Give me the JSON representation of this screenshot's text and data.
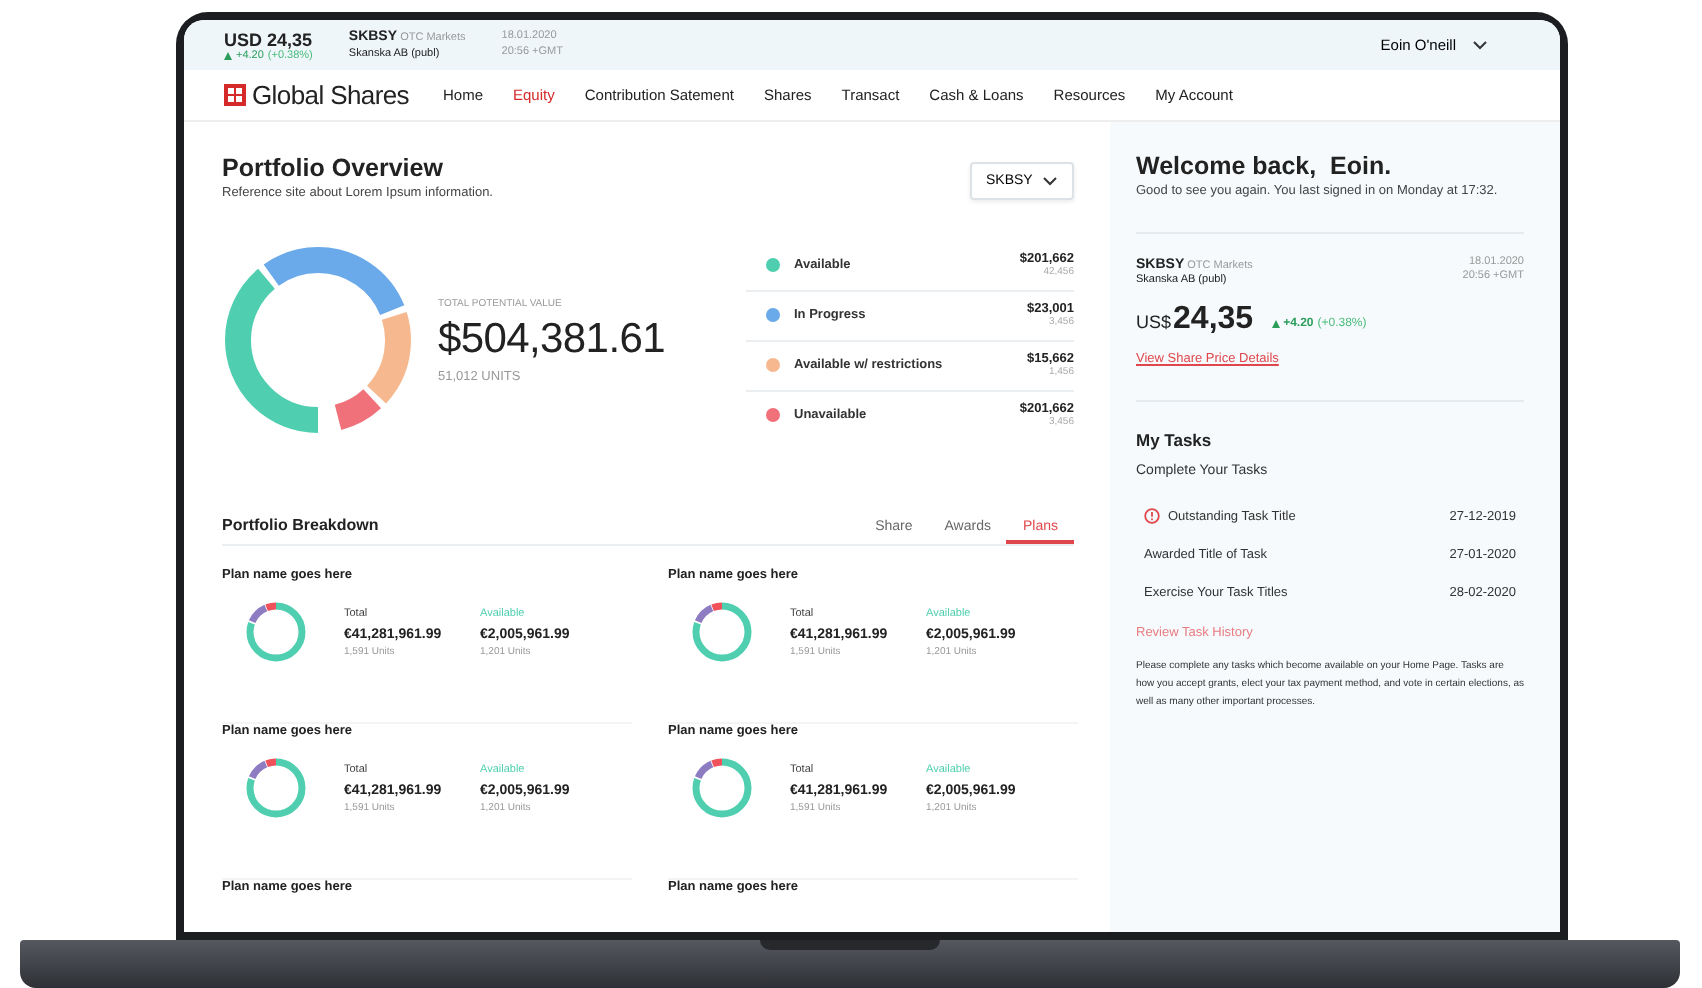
{
  "ticker": {
    "price": "USD 24,35",
    "change": "+4.20",
    "change_pct": "(+0.38%)",
    "symbol": "SKBSY",
    "market": "OTC Markets",
    "company": "Skanska AB (publ)",
    "date": "18.01.2020",
    "time": "20:56 +GMT",
    "user": "Eoin O'neill"
  },
  "brand": "Global Shares",
  "nav": [
    {
      "label": "Home",
      "selected": false
    },
    {
      "label": "Equity",
      "selected": true
    },
    {
      "label": "Contribution Satement",
      "selected": false
    },
    {
      "label": "Shares",
      "selected": false
    },
    {
      "label": "Transact",
      "selected": false
    },
    {
      "label": "Cash & Loans",
      "selected": false
    },
    {
      "label": "Resources",
      "selected": false
    },
    {
      "label": "My Account",
      "selected": false
    }
  ],
  "overview": {
    "title": "Portfolio Overview",
    "subtitle": "Reference site about Lorem Ipsum information.",
    "dropdown": "SKBSY",
    "total_label": "TOTAL POTENTIAL VALUE",
    "total": "$504,381.61",
    "units": "51,012 UNITS",
    "legend": [
      {
        "label": "Available",
        "value": "$201,662",
        "units": "42,456",
        "color": "#4fcfb0"
      },
      {
        "label": "In Progress",
        "value": "$23,001",
        "units": "3,456",
        "color": "#6aa9ea"
      },
      {
        "label": "Available w/ restrictions",
        "value": "$15,662",
        "units": "1,456",
        "color": "#f6b98f"
      },
      {
        "label": "Unavailable",
        "value": "$201,662",
        "units": "3,456",
        "color": "#f0717a"
      }
    ]
  },
  "breakdown": {
    "title": "Portfolio Breakdown",
    "tabs": [
      {
        "label": "Share",
        "selected": false
      },
      {
        "label": "Awards",
        "selected": false
      },
      {
        "label": "Plans",
        "selected": true
      }
    ],
    "plans": [
      {
        "name": "Plan name goes here",
        "total_label": "Total",
        "total": "€41,281,961.99",
        "total_units": "1,591 Units",
        "available_label": "Available",
        "available": "€2,005,961.99",
        "available_units": "1,201 Units"
      },
      {
        "name": "Plan name goes here",
        "total_label": "Total",
        "total": "€41,281,961.99",
        "total_units": "1,591 Units",
        "available_label": "Available",
        "available": "€2,005,961.99",
        "available_units": "1,201 Units"
      },
      {
        "name": "Plan name goes here",
        "total_label": "Total",
        "total": "€41,281,961.99",
        "total_units": "1,591 Units",
        "available_label": "Available",
        "available": "€2,005,961.99",
        "available_units": "1,201 Units"
      },
      {
        "name": "Plan name goes here",
        "total_label": "Total",
        "total": "€41,281,961.99",
        "total_units": "1,591 Units",
        "available_label": "Available",
        "available": "€2,005,961.99",
        "available_units": "1,201 Units"
      },
      {
        "name": "Plan name goes here"
      },
      {
        "name": "Plan name goes here"
      }
    ]
  },
  "welcome": {
    "title": "Welcome back,  Eoin.",
    "text": "Good to see you again. You last signed in on Monday at 17:32."
  },
  "quote": {
    "symbol": "SKBSY",
    "market": "OTC Markets",
    "company": "Skanska AB (publ)",
    "date": "18.01.2020",
    "time": "20:56 +GMT",
    "currency": "US$",
    "price": "24,35",
    "change": "+4.20",
    "change_pct": "(+0.38%)",
    "link": "View Share Price Details"
  },
  "tasks": {
    "title": "My Tasks",
    "subtitle": "Complete Your Tasks",
    "items": [
      {
        "title": "Outstanding Task Title",
        "date": "27-12-2019",
        "outstanding": true
      },
      {
        "title": "Awarded Title of Task",
        "date": "27-01-2020",
        "outstanding": false
      },
      {
        "title": "Exercise Your Task Titles",
        "date": "28-02-2020",
        "outstanding": false
      }
    ],
    "link": "Review Task History",
    "note": "Please complete any tasks which become available on your Home Page. Tasks are how you accept grants, elect your tax payment method, and vote in certain elections, as well as many other important processes."
  }
}
